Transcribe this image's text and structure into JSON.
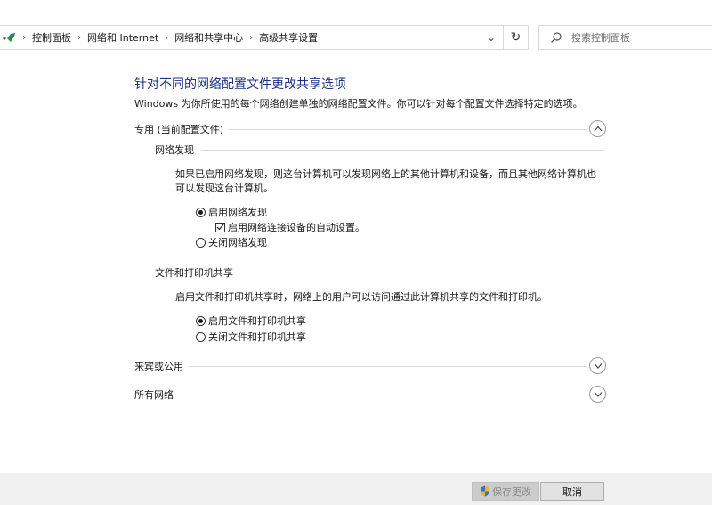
{
  "address_bar": {
    "breadcrumbs": [
      "控制面板",
      "网络和 Internet",
      "网络和共享中心",
      "高级共享设置"
    ],
    "separator": "›",
    "dropdown_glyph": "⌄",
    "refresh_glyph": "↻"
  },
  "search": {
    "placeholder": "搜索控制面板"
  },
  "page": {
    "title": "针对不同的网络配置文件更改共享选项",
    "description": "Windows 为你所使用的每个网络创建单独的网络配置文件。你可以针对每个配置文件选择特定的选项。"
  },
  "profiles": {
    "private": {
      "label": "专用 (当前配置文件)",
      "expanded": true,
      "network_discovery": {
        "heading": "网络发现",
        "desc_line1": "如果已启用网络发现，则这台计算机可以发现网络上的其他计算机和设备，而且其他网络计算机也",
        "desc_line2": "可以发现这台计算机。",
        "opt_on": "启用网络发现",
        "opt_auto_setup": "启用网络连接设备的自动设置。",
        "opt_off": "关闭网络发现",
        "selected": "on",
        "auto_setup_checked": true
      },
      "file_printer_sharing": {
        "heading": "文件和打印机共享",
        "desc": "启用文件和打印机共享时，网络上的用户可以访问通过此计算机共享的文件和打印机。",
        "opt_on": "启用文件和打印机共享",
        "opt_off": "关闭文件和打印机共享",
        "selected": "on"
      }
    },
    "guest_public": {
      "label": "来宾或公用",
      "expanded": false
    },
    "all_networks": {
      "label": "所有网络",
      "expanded": false
    }
  },
  "footer": {
    "save_label": "保存更改",
    "save_enabled": false,
    "cancel_label": "取消"
  },
  "colors": {
    "title": "#1e3287",
    "divider": "#d6d6d6",
    "footer_bg": "#f0f0f0"
  }
}
